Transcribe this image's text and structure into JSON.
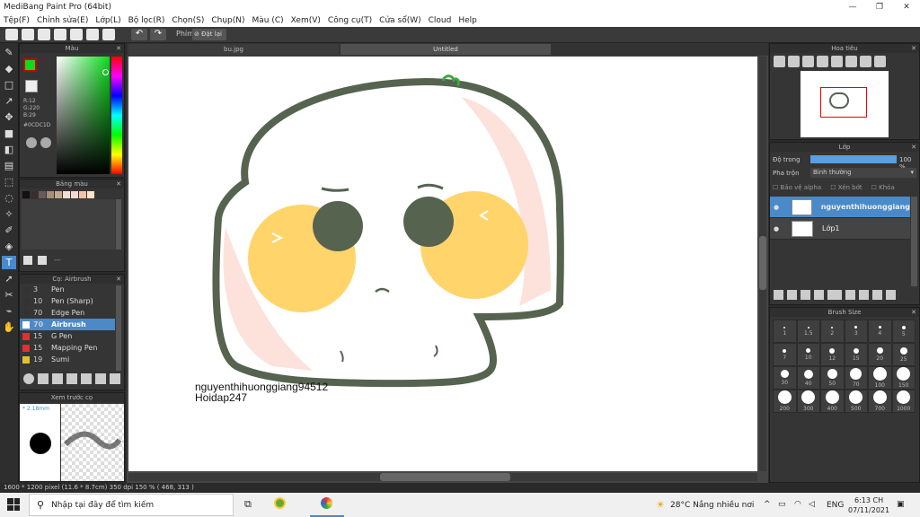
{
  "window": {
    "title": "MediBang Paint Pro (64bit)",
    "min": "—",
    "max": "❐",
    "close": "✕"
  },
  "menu": [
    "Tệp(F)",
    "Chỉnh sửa(E)",
    "Lớp(L)",
    "Bộ lọc(R)",
    "Chọn(S)",
    "Chụp(N)",
    "Màu (C)",
    "Xem(V)",
    "Công cụ(T)",
    "Cửa sổ(W)",
    "Cloud",
    "Help"
  ],
  "toolbar": {
    "shortcut_label": "Phím",
    "reset_label": "Đặt lại"
  },
  "tabs": {
    "file1": "bu.jpg",
    "file2": "Untitled"
  },
  "color_panel": {
    "title": "Màu",
    "r": "R:12",
    "g": "G:220",
    "b": "B:29",
    "hex": "#0CDC1D",
    "fg": "#0cdc1d",
    "bg": "#ffffff"
  },
  "palette_panel": {
    "title": "Bảng màu",
    "colors": [
      "#111111",
      "#3a2f2f",
      "#6b5a5a",
      "#a38f7c",
      "#c4a98d",
      "#ede0d0",
      "#f4d8d4",
      "#f2c1b0",
      "#ffe4c8"
    ]
  },
  "brush_panel": {
    "title": "Cọ: Airbrush",
    "brushes": [
      {
        "size": "3",
        "name": "Pen",
        "color": "#333333"
      },
      {
        "size": "10",
        "name": "Pen (Sharp)",
        "color": "#333333"
      },
      {
        "size": "70",
        "name": "Edge Pen",
        "color": "#333333"
      },
      {
        "size": "70",
        "name": "Airbrush",
        "color": "#ffffff"
      },
      {
        "size": "15",
        "name": "G Pen",
        "color": "#e03030"
      },
      {
        "size": "15",
        "name": "Mapping Pen",
        "color": "#e03030"
      },
      {
        "size": "19",
        "name": "Sumi",
        "color": "#e0c030"
      }
    ]
  },
  "preview_panel": {
    "title": "Xem trước cọ",
    "size_label": "* 2.18mm"
  },
  "navigator": {
    "title": "Hoa tiêu"
  },
  "layer_panel": {
    "title": "Lớp",
    "opacity_label": "Độ trong",
    "opacity_value": "100 %",
    "blend_label": "Pha trộn",
    "blend_value": "Bình thường",
    "protect_alpha": "Bảo vệ alpha",
    "clipping": "Xén bớt",
    "lock": "Khóa",
    "layers": [
      {
        "name": "nguyenthihuonggiang",
        "selected": true
      },
      {
        "name": "Lớp1",
        "selected": false
      }
    ]
  },
  "brush_size_panel": {
    "title": "Brush Size",
    "sizes": [
      "1",
      "1.5",
      "2",
      "3",
      "4",
      "5",
      "7",
      "10",
      "12",
      "15",
      "20",
      "25",
      "30",
      "40",
      "50",
      "70",
      "100",
      "150",
      "200",
      "300",
      "400",
      "500",
      "700",
      "1000"
    ]
  },
  "canvas_text": {
    "line1": "nguyenthihuonggiang94512",
    "line2": "Hoidap247"
  },
  "status": "1600 * 1200 pixel   (11.6 * 8.7cm)  350 dpi   150 %   ( 468, 313 )",
  "taskbar": {
    "search_placeholder": "Nhập tại đây để tìm kiếm",
    "weather": "28°C  Nắng nhiều nơi",
    "lang": "ENG",
    "time": "6:13 CH",
    "date": "07/11/2021"
  }
}
